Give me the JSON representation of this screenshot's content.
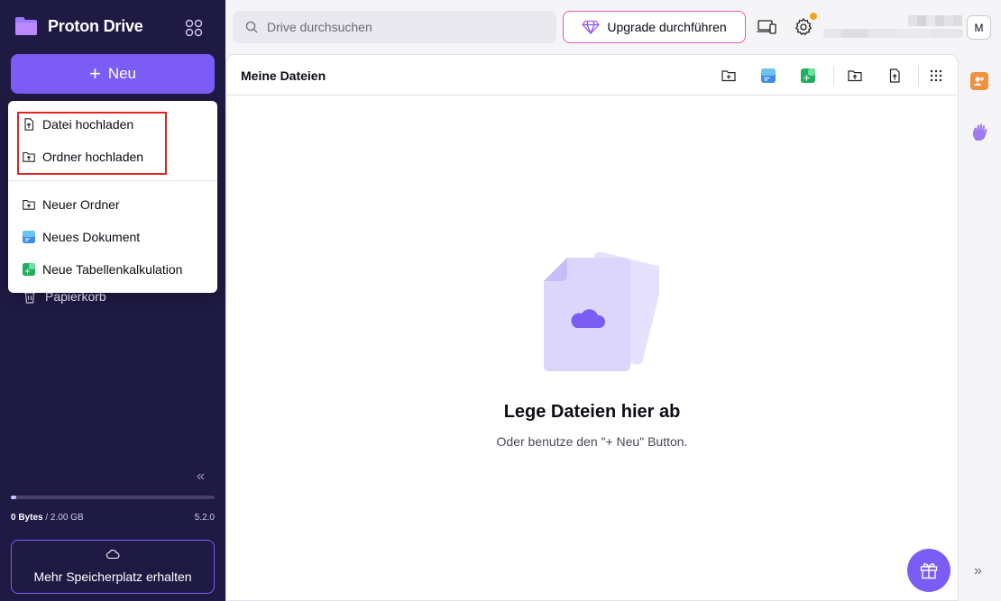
{
  "app": {
    "name": "Proton Drive",
    "version": "5.2.0",
    "accent": "#7b5cf5",
    "sidebar_bg": "#1f1a43"
  },
  "sidebar": {
    "new_button_label": "Neu",
    "trash_label": "Papierkorb",
    "storage": {
      "used": "0 Bytes",
      "separator": "/",
      "total": "2.00 GB",
      "used_fraction": 0.0
    },
    "more_storage_label": "Mehr Speicherplatz erhalten"
  },
  "new_menu": {
    "items": [
      {
        "label": "Datei hochladen",
        "icon": "file-upload-icon"
      },
      {
        "label": "Ordner hochladen",
        "icon": "folder-upload-icon"
      },
      {
        "label": "Neuer Ordner",
        "icon": "folder-plus-icon"
      },
      {
        "label": "Neues Dokument",
        "icon": "document-icon"
      },
      {
        "label": "Neue Tabellenkalkulation",
        "icon": "spreadsheet-icon"
      }
    ]
  },
  "header": {
    "search_placeholder": "Drive durchsuchen",
    "upgrade_label": "Upgrade durchführen",
    "avatar_initial": "M"
  },
  "main": {
    "title": "Meine Dateien",
    "empty_title": "Lege Dateien hier ab",
    "empty_subtitle": "Oder benutze den \"+ Neu\" Button."
  }
}
